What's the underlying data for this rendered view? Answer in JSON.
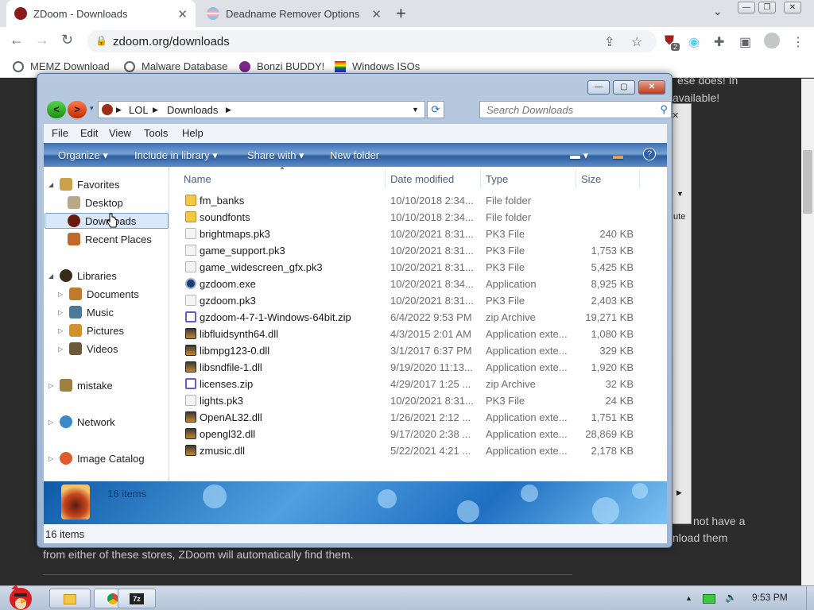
{
  "browser": {
    "tabs": [
      {
        "title": "ZDoom - Downloads",
        "active": true
      },
      {
        "title": "Deadname Remover Options",
        "active": false
      }
    ],
    "url": "zdoom.org/downloads",
    "bookmarks": [
      "MEMZ Download",
      "Malware Database",
      "Bonzi BUDDY!",
      "Windows ISOs"
    ],
    "extension_badge": "2"
  },
  "page": {
    "text_right_1": "ese does! In",
    "text_right_2": "available!",
    "text_bottom_1": "not have a",
    "text_bottom_2": "nload them",
    "text_bottom_3": "from either of these stores, ZDoom will automatically find them.",
    "bg_dialog_field": "ute"
  },
  "explorer": {
    "breadcrumb": [
      "LOL",
      "Downloads"
    ],
    "search_placeholder": "Search Downloads",
    "menus": [
      "File",
      "Edit",
      "View",
      "Tools",
      "Help"
    ],
    "commands": [
      "Organize",
      "Include in library",
      "Share with",
      "New folder"
    ],
    "nav": {
      "favorites": "Favorites",
      "desktop": "Desktop",
      "downloads": "Downloads",
      "recent": "Recent Places",
      "libraries": "Libraries",
      "documents": "Documents",
      "music": "Music",
      "pictures": "Pictures",
      "videos": "Videos",
      "mistake": "mistake",
      "network": "Network",
      "image_catalog": "Image Catalog"
    },
    "columns": [
      "Name",
      "Date modified",
      "Type",
      "Size"
    ],
    "files": [
      {
        "name": "fm_banks",
        "date": "10/10/2018 2:34...",
        "type": "File folder",
        "size": "",
        "icon": "folder-icon"
      },
      {
        "name": "soundfonts",
        "date": "10/10/2018 2:34...",
        "type": "File folder",
        "size": "",
        "icon": "folder-icon"
      },
      {
        "name": "brightmaps.pk3",
        "date": "10/20/2021 8:31...",
        "type": "PK3 File",
        "size": "240 KB",
        "icon": "file-icon"
      },
      {
        "name": "game_support.pk3",
        "date": "10/20/2021 8:31...",
        "type": "PK3 File",
        "size": "1,753 KB",
        "icon": "file-icon"
      },
      {
        "name": "game_widescreen_gfx.pk3",
        "date": "10/20/2021 8:31...",
        "type": "PK3 File",
        "size": "5,425 KB",
        "icon": "file-icon"
      },
      {
        "name": "gzdoom.exe",
        "date": "10/20/2021 8:34...",
        "type": "Application",
        "size": "8,925 KB",
        "icon": "gzdoom-icon"
      },
      {
        "name": "gzdoom.pk3",
        "date": "10/20/2021 8:31...",
        "type": "PK3 File",
        "size": "2,403 KB",
        "icon": "file-icon"
      },
      {
        "name": "gzdoom-4-7-1-Windows-64bit.zip",
        "date": "6/4/2022 9:53 PM",
        "type": "zip Archive",
        "size": "19,271 KB",
        "icon": "zip-icon"
      },
      {
        "name": "libfluidsynth64.dll",
        "date": "4/3/2015 2:01 AM",
        "type": "Application exte...",
        "size": "1,080 KB",
        "icon": "dll-icon"
      },
      {
        "name": "libmpg123-0.dll",
        "date": "3/1/2017 6:37 PM",
        "type": "Application exte...",
        "size": "329 KB",
        "icon": "dll-icon"
      },
      {
        "name": "libsndfile-1.dll",
        "date": "9/19/2020 11:13...",
        "type": "Application exte...",
        "size": "1,920 KB",
        "icon": "dll-icon"
      },
      {
        "name": "licenses.zip",
        "date": "4/29/2017 1:25 ...",
        "type": "zip Archive",
        "size": "32 KB",
        "icon": "zip-icon"
      },
      {
        "name": "lights.pk3",
        "date": "10/20/2021 8:31...",
        "type": "PK3 File",
        "size": "24 KB",
        "icon": "file-icon"
      },
      {
        "name": "OpenAL32.dll",
        "date": "1/26/2021 2:12 ...",
        "type": "Application exte...",
        "size": "1,751 KB",
        "icon": "dll-icon"
      },
      {
        "name": "opengl32.dll",
        "date": "9/17/2020 2:38 ...",
        "type": "Application exte...",
        "size": "28,869 KB",
        "icon": "dll-icon"
      },
      {
        "name": "zmusic.dll",
        "date": "5/22/2021 4:21 ...",
        "type": "Application exte...",
        "size": "2,178 KB",
        "icon": "dll-icon"
      }
    ],
    "details_count": "16 items",
    "status_count": "16 items"
  },
  "taskbar": {
    "clock": "9:53 PM"
  }
}
